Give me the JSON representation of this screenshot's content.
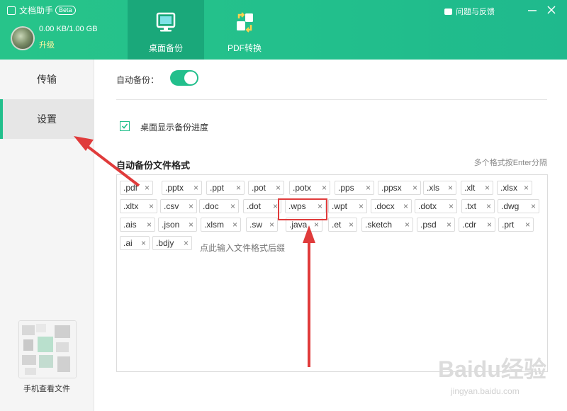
{
  "header": {
    "app_title": "文档助手",
    "beta_badge": "Beta",
    "storage": "0.00 KB/1.00 GB",
    "upgrade": "升级",
    "tabs": [
      {
        "label": "桌面备份",
        "icon": "monitor-icon",
        "active": true
      },
      {
        "label": "PDF转换",
        "icon": "convert-icon",
        "active": false
      }
    ],
    "feedback": "问题与反馈",
    "minimize_icon": "minimize-icon",
    "close_icon": "close-icon"
  },
  "sidebar": {
    "items": [
      {
        "label": "传输",
        "active": false
      },
      {
        "label": "设置",
        "active": true
      }
    ],
    "phone_label": "手机查看文件"
  },
  "settings": {
    "auto_backup_label": "自动备份：",
    "auto_backup_on": true,
    "show_progress_label": "桌面显示备份进度",
    "show_progress_checked": true,
    "formats_title": "自动备份文件格式",
    "formats_hint": "多个格式按Enter分隔",
    "formats": [
      ".pdf",
      ".pptx",
      ".ppt",
      ".pot",
      ".potx",
      ".pps",
      ".ppsx",
      ".xls",
      ".xlt",
      ".xlsx",
      ".xltx",
      ".csv",
      ".doc",
      ".dot",
      ".wps",
      ".wpt",
      ".docx",
      ".dotx",
      ".txt",
      ".dwg",
      ".ais",
      ".json",
      ".xlsm",
      ".sw",
      ".java",
      ".et",
      ".sketch",
      ".psd",
      ".cdr",
      ".prt",
      ".ai",
      ".bdjy"
    ],
    "input_placeholder": "点此输入文件格式后缀",
    "highlighted_format": ".wps"
  },
  "annotations": {
    "arrow_color": "#e03b3b"
  },
  "watermark": {
    "brand": "Baidu经验",
    "url": "jingyan.baidu.com"
  },
  "colors": {
    "accent": "#22bf8c",
    "header_tab_active": "#1aa87a",
    "annotation_red": "#e03b3b"
  }
}
